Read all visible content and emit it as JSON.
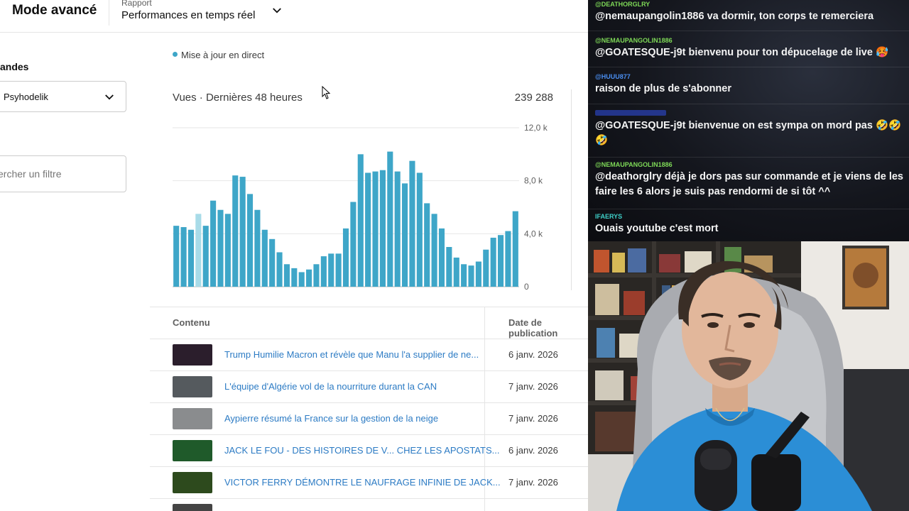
{
  "header": {
    "mode_title": "Mode avancé",
    "report_caption": "Rapport",
    "report_value": "Performances en temps réel"
  },
  "sidebar": {
    "heading_fragment": "andes",
    "channel_value": "Psyhodelik",
    "filter_placeholder": "ercher un filtre"
  },
  "live": {
    "label": "Mise à jour en direct",
    "color": "#3ea6c8"
  },
  "chart_data": {
    "type": "bar",
    "title": "Vues · Dernières 48 heures",
    "total": "239 288",
    "ylim": [
      0,
      12000
    ],
    "yticks": [
      {
        "value": 0,
        "label": "0"
      },
      {
        "value": 4000,
        "label": "4,0 k"
      },
      {
        "value": 8000,
        "label": "8,0 k"
      },
      {
        "value": 12000,
        "label": "12,0 k"
      }
    ],
    "bar_color": "#3ea6c8",
    "highlight_color": "#a8dbe8",
    "highlight_index": 3,
    "values": [
      4600,
      4500,
      4300,
      5500,
      4600,
      6500,
      5800,
      5500,
      8400,
      8300,
      7000,
      5800,
      4300,
      3600,
      2600,
      1700,
      1400,
      1100,
      1300,
      1700,
      2300,
      2500,
      2500,
      4400,
      6400,
      10000,
      8600,
      8700,
      8800,
      10200,
      8700,
      7800,
      9500,
      8600,
      6300,
      5500,
      4400,
      3000,
      2200,
      1700,
      1600,
      1900,
      2800,
      3700,
      3900,
      4200,
      5700
    ]
  },
  "table": {
    "col_content": "Contenu",
    "col_date": "Date de publication",
    "rows": [
      {
        "title": "Trump Humilie Macron et révèle que Manu l'a supplier de ne...",
        "date": "6 janv. 2026",
        "thumb_color": "#2b1e2c"
      },
      {
        "title": "L'équipe d'Algérie vol de la nourriture durant la CAN",
        "date": "7 janv. 2026",
        "thumb_color": "#555a5e"
      },
      {
        "title": "Aypierre résumé la France sur la gestion de la neige",
        "date": "7 janv. 2026",
        "thumb_color": "#8a8c8e"
      },
      {
        "title": "JACK LE FOU - DES HISTOIRES DE V... CHEZ LES APOSTATS...",
        "date": "6 janv. 2026",
        "thumb_color": "#1f5a2a"
      },
      {
        "title": "VICTOR FERRY DÉMONTRE LE NAUFRAGE INFINIE DE JACK...",
        "date": "7 janv. 2026",
        "thumb_color": "#2d4a1d"
      },
      {
        "title": "",
        "date": "",
        "thumb_color": "#444444"
      }
    ]
  },
  "chat": {
    "messages": [
      {
        "user": "@DEATHORGLRY",
        "user_color": "#7ed957",
        "text": "@nemaupangolin1886 va dormir, ton corps te remerciera"
      },
      {
        "user": "@NEMAUPANGOLIN1886",
        "user_color": "#7ed957",
        "text": "@GOATESQUE-j9t bienvenu pour ton dépucelage de live 🥵"
      },
      {
        "user": "@HUUU877",
        "user_color": "#4a8ef0",
        "text": "raison de plus de s'abonner"
      },
      {
        "user": "",
        "user_color": "#2f4bd6",
        "text": "@GOATESQUE-j9t bienvenue on est sympa on mord pas 🤣🤣🤣"
      },
      {
        "user": "@NEMAUPANGOLIN1886",
        "user_color": "#7ed957",
        "text": "@deathorglry déjà je dors pas sur commande et je viens de les faire les 6 alors je suis pas rendormi de si tôt ^^"
      },
      {
        "user": "IFAERYS",
        "user_color": "#3ed0c8",
        "text": "Ouais youtube c'est mort"
      }
    ]
  }
}
